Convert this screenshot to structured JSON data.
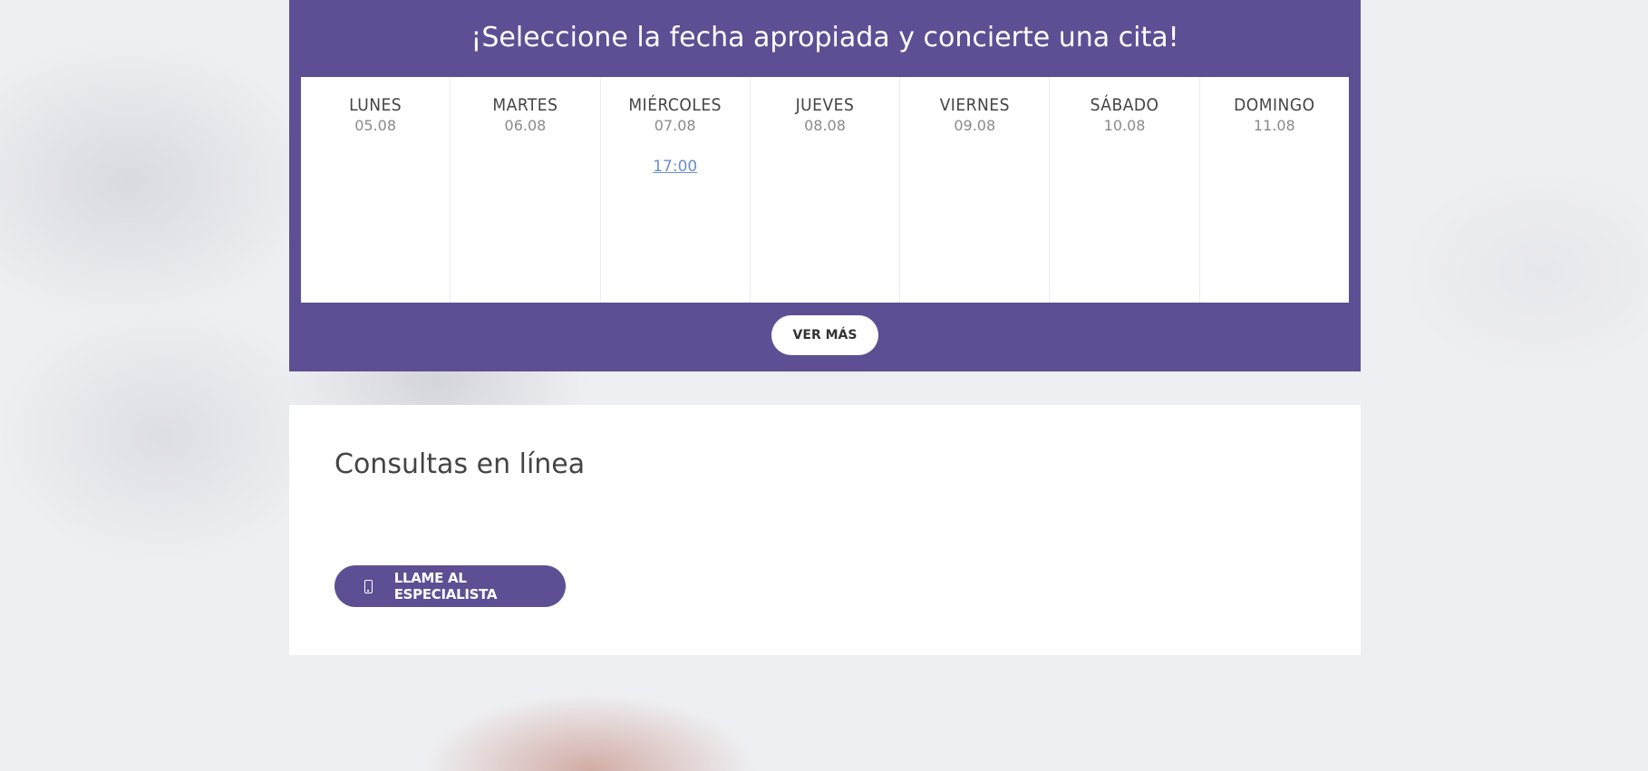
{
  "booking": {
    "title": "¡Seleccione la fecha apropiada y concierte una cita!",
    "days": [
      {
        "name": "LUNES",
        "date": "05.08",
        "slots": []
      },
      {
        "name": "MARTES",
        "date": "06.08",
        "slots": []
      },
      {
        "name": "MIÉRCOLES",
        "date": "07.08",
        "slots": [
          "17:00"
        ]
      },
      {
        "name": "JUEVES",
        "date": "08.08",
        "slots": []
      },
      {
        "name": "VIERNES",
        "date": "09.08",
        "slots": []
      },
      {
        "name": "SÁBADO",
        "date": "10.08",
        "slots": []
      },
      {
        "name": "DOMINGO",
        "date": "11.08",
        "slots": []
      }
    ],
    "more_label": "VER MÁS"
  },
  "consult": {
    "title": "Consultas en línea",
    "call_label": "LLAME AL ESPECIALISTA",
    "call_icon": "phone-icon"
  },
  "colors": {
    "brand": "#5e4f94",
    "link": "#6a8fc8"
  }
}
